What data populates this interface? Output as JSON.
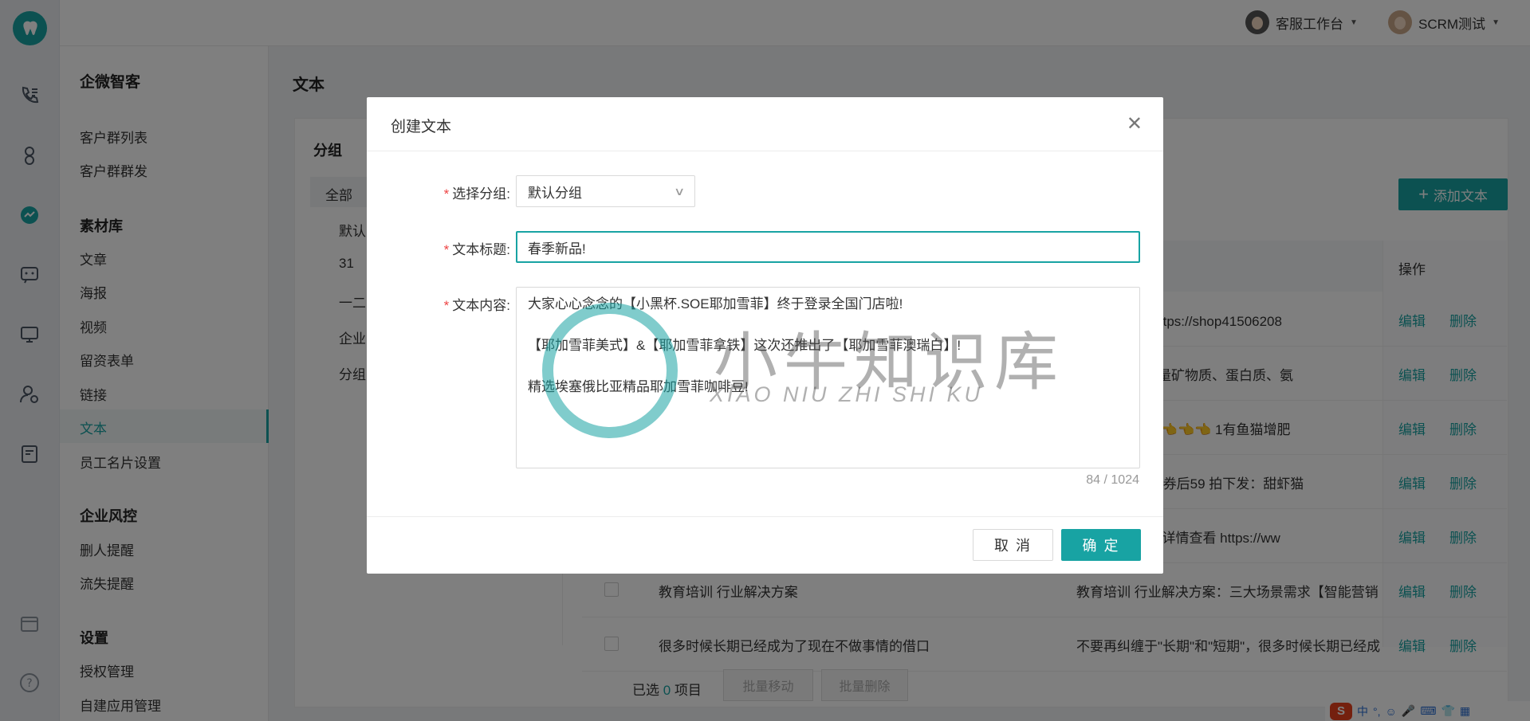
{
  "header": {
    "service_workbench": "客服工作台",
    "user_name": "SCRM测试"
  },
  "sidebar": {
    "app_title": "企微智客",
    "items_top": [
      "客户群列表",
      "客户群群发"
    ],
    "material_section": "素材库",
    "material_items": [
      "文章",
      "海报",
      "视频",
      "留资表单",
      "链接",
      "文本",
      "员工名片设置"
    ],
    "risk_section": "企业风控",
    "risk_items": [
      "删人提醒",
      "流失提醒"
    ],
    "settings_section": "设置",
    "settings_items": [
      "授权管理",
      "自建应用管理"
    ]
  },
  "main": {
    "title": "文本",
    "group_title": "分组",
    "groups": [
      "全部",
      "默认",
      "31",
      "一二",
      "企业",
      "分组"
    ],
    "add_button": "添加文本",
    "op_header": "操作",
    "edit_label": "编辑",
    "delete_label": "删除",
    "rows": [
      {
        "title": "",
        "content": "晶 试试这个 https://shop41506208"
      },
      {
        "title": "",
        "content": "丰富，富含大量矿物质、蛋白质、氨"
      },
      {
        "title": "",
        "content": "👈👈👈👈👈👈👈👈 1有鱼猫增肥"
      },
      {
        "title": "",
        "content": "大礼包 原79，券后59 拍下发：甜虾猫"
      },
      {
        "title": "",
        "content": "知道行不行🙃 详情查看 https://ww"
      },
      {
        "title": "教育培训 行业解决方案",
        "content": "教育培训 行业解决方案：三大场景需求【智能营销"
      },
      {
        "title": "很多时候长期已经成为了现在不做事情的借口",
        "content": "不要再纠缠于\"长期\"和\"短期\"，很多时候长期已经成"
      }
    ],
    "selected_prefix": "已选",
    "selected_count": "0",
    "selected_suffix": "项目",
    "batch_move": "批量移动",
    "batch_delete": "批量删除"
  },
  "dialog": {
    "title": "创建文本",
    "group_label": "选择分组:",
    "group_value": "默认分组",
    "title_label": "文本标题:",
    "title_value": "春季新品!",
    "content_label": "文本内容:",
    "content_lines": [
      "大家心心念念的【小黑杯.SOE耶加雪菲】终于登录全国门店啦!",
      "",
      "【耶加雪菲美式】&【耶加雪菲拿铁】这次还推出了【耶加雪菲澳瑞白】!",
      "",
      "精选埃塞俄比亚精品耶加雪菲咖啡豆!"
    ],
    "char_count": "84 / 1024",
    "cancel": "取 消",
    "confirm": "确 定"
  },
  "watermark": {
    "cn": "小牛知识库",
    "en": "XIAO NIU ZHI SHI KU"
  },
  "ime": {
    "logo": "S",
    "mode": "中"
  },
  "colors": {
    "accent": "#18a3a3",
    "required": "#e44444"
  }
}
